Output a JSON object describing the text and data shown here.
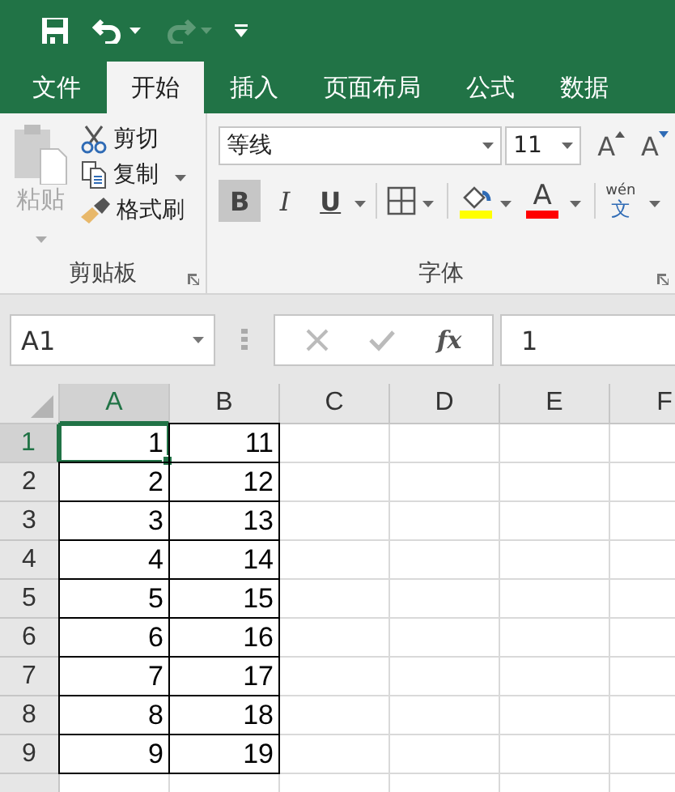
{
  "quick_access": [
    {
      "kind": "save",
      "disabled": false
    },
    {
      "kind": "undo",
      "disabled": false
    },
    {
      "kind": "redo",
      "disabled": true
    },
    {
      "kind": "customize",
      "disabled": false
    }
  ],
  "tabs": [
    {
      "label": "文件",
      "selected": false
    },
    {
      "label": "开始",
      "selected": true
    },
    {
      "label": "插入",
      "selected": false
    },
    {
      "label": "页面布局",
      "selected": false
    },
    {
      "label": "公式",
      "selected": false
    },
    {
      "label": "数据",
      "selected": false
    }
  ],
  "clipboard": {
    "title": "剪贴板",
    "paste": {
      "label": "粘贴",
      "disabled": true
    },
    "items": [
      {
        "kind": "cut",
        "label": "剪切"
      },
      {
        "kind": "copy",
        "label": "复制"
      },
      {
        "kind": "painter",
        "label": "格式刷"
      }
    ]
  },
  "font": {
    "title": "字体",
    "name": "等线",
    "size": "11",
    "grow": "A",
    "shrink": "A",
    "styles": [
      {
        "label": "B",
        "kind": "bold",
        "on": true
      },
      {
        "label": "I",
        "kind": "italic",
        "on": false
      },
      {
        "label": "U",
        "kind": "underline",
        "on": false
      }
    ],
    "fill": {
      "color": "#ffff00"
    },
    "font_color": {
      "label": "A",
      "color": "#ff0000"
    },
    "phonetic": {
      "top": "wén",
      "bottom": "文"
    }
  },
  "formula_bar": {
    "name_box": "A1",
    "fx": "fx",
    "value": "1"
  },
  "sheet": {
    "columns": [
      {
        "label": "A",
        "selected": true
      },
      {
        "label": "B",
        "selected": false
      },
      {
        "label": "C",
        "selected": false
      },
      {
        "label": "D",
        "selected": false
      },
      {
        "label": "E",
        "selected": false
      },
      {
        "label": "F",
        "selected": false
      }
    ],
    "bordered": true,
    "rows": [
      {
        "header": "1",
        "selected": true,
        "cells": [
          "1",
          "11"
        ]
      },
      {
        "header": "2",
        "selected": false,
        "cells": [
          "2",
          "12"
        ]
      },
      {
        "header": "3",
        "selected": false,
        "cells": [
          "3",
          "13"
        ]
      },
      {
        "header": "4",
        "selected": false,
        "cells": [
          "4",
          "14"
        ]
      },
      {
        "header": "5",
        "selected": false,
        "cells": [
          "5",
          "15"
        ]
      },
      {
        "header": "6",
        "selected": false,
        "cells": [
          "6",
          "16"
        ]
      },
      {
        "header": "7",
        "selected": false,
        "cells": [
          "7",
          "17"
        ]
      },
      {
        "header": "8",
        "selected": false,
        "cells": [
          "8",
          "18"
        ]
      },
      {
        "header": "9",
        "selected": false,
        "cells": [
          "9",
          "19"
        ]
      }
    ]
  }
}
